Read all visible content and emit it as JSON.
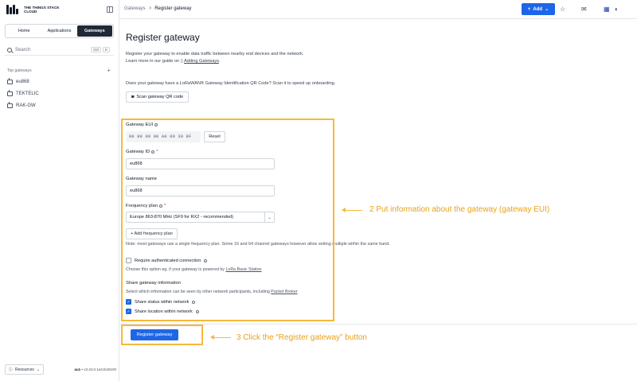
{
  "brand": {
    "line1": "THE THINGS STACK",
    "line2": "CLOUD"
  },
  "nav_tabs": [
    {
      "label": "Home",
      "active": false
    },
    {
      "label": "Applications",
      "active": false
    },
    {
      "label": "Gateways",
      "active": true
    }
  ],
  "search": {
    "label": "Search",
    "kbd1": "Ctrl",
    "kbd2": "K"
  },
  "sidebar": {
    "top_gateways_label": "Top gateways",
    "add_symbol": "+",
    "gateways": [
      "eu868",
      "TEKTELIC",
      "RAK-GW"
    ]
  },
  "footer": {
    "resources_label": "Resources",
    "cluster": "au1",
    "version": "v3.34.0.1e2cb40100"
  },
  "breadcrumb": {
    "parent": "Gateways",
    "separator": ">",
    "current": "Register gateway"
  },
  "toolbar": {
    "add_label": "Add",
    "star": "☆",
    "inbox": "✉",
    "help": "◐"
  },
  "page": {
    "title": "Register gateway",
    "intro_line1": "Register your gateway to enable data traffic between nearby end devices and the network.",
    "intro_line2_prefix": "Learn more in our guide on",
    "intro_link": "Adding Gateways",
    "intro_line2_suffix": ".",
    "qr_question": "Does your gateway have a LoRaWAN® Gateway Identification QR Code? Scan it to speed up onboarding.",
    "qr_button": "Scan gateway QR code"
  },
  "form": {
    "eui_label": "Gateway EUI",
    "eui_value": "00 80 00 00 A0 00 30 8F",
    "reset_label": "Reset",
    "id_label": "Gateway ID",
    "id_value": "eu868",
    "required_mark": "*",
    "name_label": "Gateway name",
    "name_value": "eu868",
    "freq_label": "Frequency plan",
    "freq_value": "Europe 863-870 MHz (SF9 for RX2 - recommended)",
    "add_freq_label": "+ Add frequency plan",
    "freq_note": "Note: most gateways use a single frequency plan. Some 16 and 64 channel gateways however allow setting multiple within the same band.",
    "auth_label": "Require authenticated connection",
    "auth_checked": false,
    "auth_hint_prefix": "Choose this option eg. if your gateway is powered by",
    "auth_hint_link": "LoRa Basic Station",
    "share_title": "Share gateway information",
    "share_hint_prefix": "Select which information can be seen by other network participants, including",
    "share_hint_link": "Packet Broker",
    "share_status_label": "Share status within network",
    "share_status_checked": true,
    "share_location_label": "Share location within network",
    "share_location_checked": true,
    "register_label": "Register gateway"
  },
  "annotations": {
    "step2": "2 Put information about the gateway (gateway EUI)",
    "step3": "3 Click the “Register gateway” button",
    "color": "#f6b93b"
  }
}
